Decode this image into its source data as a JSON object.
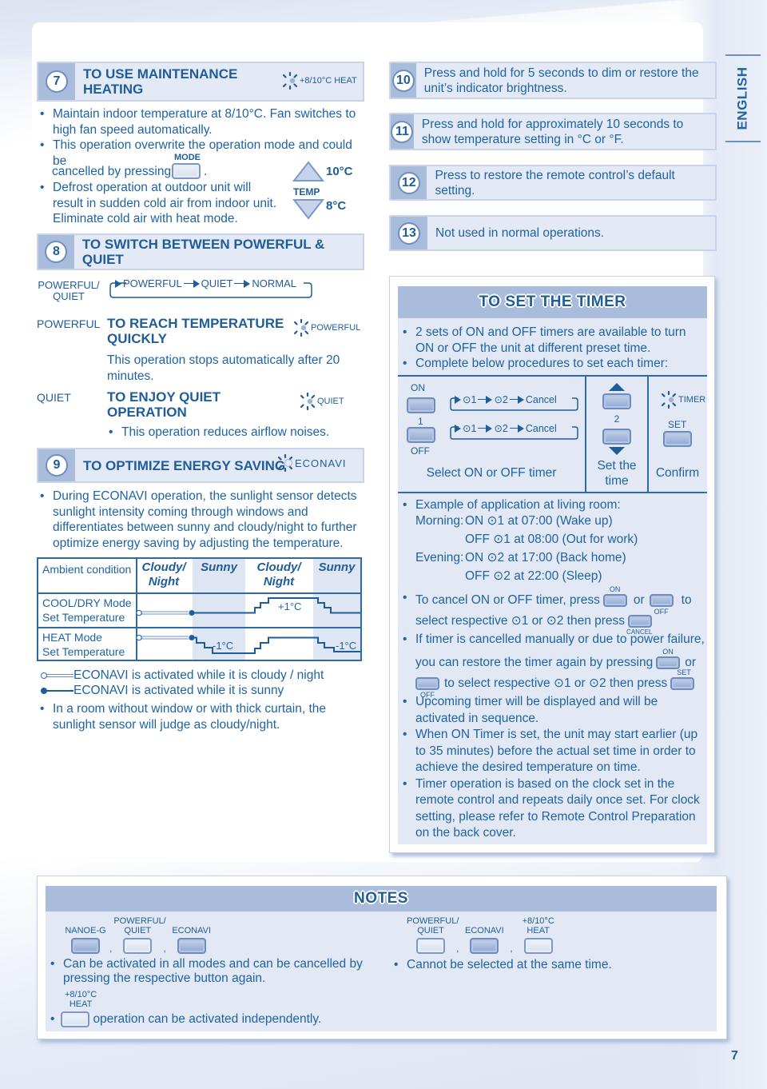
{
  "page": {
    "language_tab": "ENGLISH",
    "page_number": "7"
  },
  "sec7": {
    "number": "7",
    "title_line1": "TO USE MAINTENANCE",
    "title_line2": "HEATING",
    "indicator_label": "+8/10°C HEAT",
    "bullets": [
      "Maintain indoor temperature at 8/10°C. Fan switches to high fan speed automatically.",
      "This operation overwrite the operation mode and could be",
      "cancelled by pressing",
      "Defrost operation at outdoor unit will result in sudden cold air from indoor unit. Eliminate cold air with heat mode."
    ],
    "mode_button_label": "MODE",
    "temp_label": "TEMP",
    "temp_up_value": "10°C",
    "temp_down_value": "8°C"
  },
  "sec8": {
    "number": "8",
    "title": "TO SWITCH BETWEEN POWERFUL & QUIET",
    "button_label_line1": "POWERFUL/",
    "button_label_line2": "QUIET",
    "cycle": [
      "POWERFUL",
      "QUIET",
      "NORMAL"
    ],
    "powerful": {
      "label": "POWERFUL",
      "title_line1": "TO REACH TEMPERATURE",
      "title_line2": "QUICKLY",
      "indicator_label": "POWERFUL",
      "desc": "This operation stops automatically after 20 minutes."
    },
    "quiet": {
      "label": "QUIET",
      "title_line1": "TO ENJOY QUIET",
      "title_line2": "OPERATION",
      "indicator_label": "QUIET",
      "desc": "This operation reduces airflow noises."
    }
  },
  "sec9": {
    "number": "9",
    "title": "TO OPTIMIZE ENERGY SAVING",
    "indicator_label": "ECONAVI",
    "bullet1": "During ECONAVI operation, the sunlight sensor detects sunlight intensity coming through windows and differentiates between sunny and cloudy/night to further optimize energy saving by adjusting the temperature.",
    "table": {
      "header_label": "Ambient condition",
      "columns": [
        "Cloudy/ Night",
        "Sunny",
        "Cloudy/ Night",
        "Sunny"
      ],
      "rows": [
        {
          "label_line1": "COOL/DRY Mode",
          "label_line2": "Set Temperature",
          "annotation": "+1°C"
        },
        {
          "label_line1": "HEAT Mode",
          "label_line2": "Set Temperature",
          "annotation": "-1°C",
          "annotation2": "-1°C"
        }
      ]
    },
    "legend": [
      {
        "marker": "open-circle",
        "text": "ECONAVI is activated while it is cloudy / night"
      },
      {
        "marker": "filled-circle",
        "text": "ECONAVI is activated while it is sunny"
      }
    ],
    "bullet2": "In a room without window or with thick curtain, the sunlight sensor will judge as cloudy/night."
  },
  "items": [
    {
      "number": "10",
      "text": "Press and hold for 5 seconds to dim or restore the unit’s indicator brightness."
    },
    {
      "number": "11",
      "text": "Press and hold for approximately 10 seconds to show temperature setting in °C or °F."
    },
    {
      "number": "12",
      "text": "Press to restore the remote control’s default setting."
    },
    {
      "number": "13",
      "text": "Not used in normal operations."
    }
  ],
  "timer": {
    "title": "TO SET THE TIMER",
    "intro": [
      "2 sets of ON and OFF timers are available to turn ON or OFF the unit at different preset time.",
      "Complete below procedures to set each timer:"
    ],
    "steps": {
      "on_label": "ON",
      "step1_num": "1",
      "off_label": "OFF",
      "cycle": [
        "⊙1",
        "⊙2",
        "Cancel"
      ],
      "step2_num": "2",
      "timer_indicator": "TIMER",
      "set_label": "SET",
      "captions": [
        "Select ON or OFF timer",
        "Set the time",
        "Confirm"
      ]
    },
    "example_title": "Example of application at living room:",
    "example": [
      {
        "period": "Morning:",
        "text": "ON ⊙1 at 07:00 (Wake up)"
      },
      {
        "period": "",
        "text": "OFF ⊙1 at 08:00 (Out for work)"
      },
      {
        "period": "Evening:",
        "text": "ON ⊙2 at 17:00 (Back home)"
      },
      {
        "period": "",
        "text": "OFF ⊙2 at 22:00 (Sleep)"
      }
    ],
    "cancel_line1_a": "To cancel ON or OFF timer, press",
    "cancel_line1_or": "or",
    "cancel_line1_b": "to",
    "cancel_line2": "select respective ⊙1 or ⊙2 then press",
    "cancel_btn_label": "CANCEL",
    "restore_line1": "If timer is cancelled manually or due to power failure,",
    "restore_line2": "you can restore the timer again by pressing",
    "restore_line2_or": "or",
    "restore_line3": "to select respective ⊙1 or ⊙2 then press",
    "on_small": "ON",
    "off_small": "OFF",
    "set_small": "SET",
    "bullets_more": [
      "Upcoming timer will be displayed and will be activated in sequence.",
      "When ON Timer is set, the unit may start earlier (up to 35 minutes) before the actual set time in order to achieve the desired temperature on time.",
      "Timer operation is based on the clock set in the remote control and repeats daily once set. For clock setting, please refer to Remote Control Preparation on the back cover."
    ]
  },
  "notes": {
    "title": "NOTES",
    "left_buttons": [
      {
        "label_line1": "",
        "label_line2": "NANOE-G"
      },
      {
        "label_line1": "POWERFUL/",
        "label_line2": "QUIET"
      },
      {
        "label_line1": "",
        "label_line2": "ECONAVI"
      }
    ],
    "left_text": "Can be activated in all modes and can be cancelled by pressing the respective button again.",
    "heat_label_line1": "+8/10°C",
    "heat_label_line2": "HEAT",
    "heat_text": "operation can be activated independently.",
    "right_buttons": [
      {
        "label_line1": "POWERFUL/",
        "label_line2": "QUIET"
      },
      {
        "label_line1": "",
        "label_line2": "ECONAVI"
      },
      {
        "label_line1": "+8/10°C",
        "label_line2": "HEAT"
      }
    ],
    "right_text": "Cannot be selected at the same time."
  }
}
